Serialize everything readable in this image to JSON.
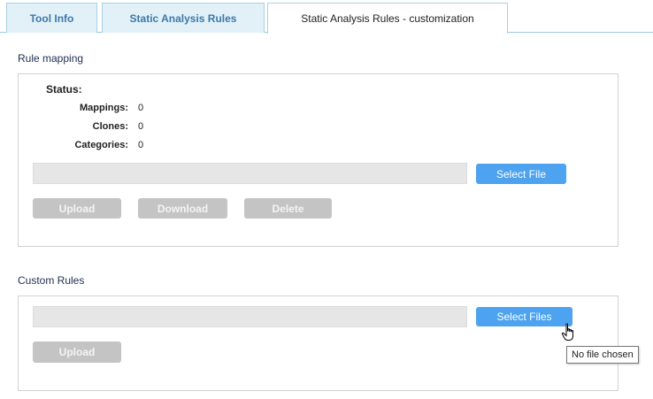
{
  "tabs": [
    {
      "label": "Tool Info",
      "active": false
    },
    {
      "label": "Static Analysis Rules",
      "active": false
    },
    {
      "label": "Static Analysis Rules - customization",
      "active": true
    }
  ],
  "rule_mapping": {
    "title": "Rule mapping",
    "status_label": "Status:",
    "stats": [
      {
        "key": "Mappings:",
        "value": "0"
      },
      {
        "key": "Clones:",
        "value": "0"
      },
      {
        "key": "Categories:",
        "value": "0"
      }
    ],
    "select_button": "Select File",
    "upload_button": "Upload",
    "download_button": "Download",
    "delete_button": "Delete"
  },
  "custom_rules": {
    "title": "Custom Rules",
    "select_button": "Select Files",
    "upload_button": "Upload",
    "tooltip": "No file chosen"
  },
  "colors": {
    "primary_button": "#4da3ef",
    "disabled_button": "#c4c4c4",
    "tab_inactive_bg": "#e2f1f8",
    "tab_inactive_text": "#3e78a8"
  },
  "icons": {
    "cursor": "hand-pointer-icon"
  }
}
